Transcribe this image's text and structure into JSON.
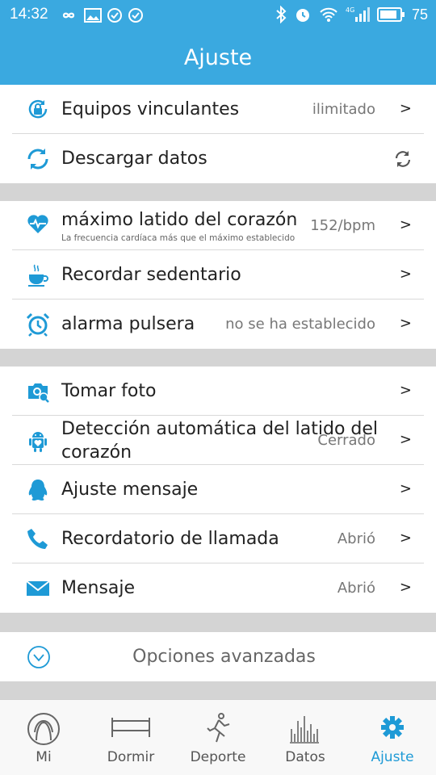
{
  "status_bar": {
    "time": "14:32",
    "battery": "75",
    "signal_label": "4G"
  },
  "header": {
    "title": "Ajuste"
  },
  "sections": [
    {
      "rows": [
        {
          "label": "Equipos vinculantes",
          "value": "ilimitado",
          "chevron": ">",
          "icon": "lock-sync-icon"
        },
        {
          "label": "Descargar datos",
          "value": "",
          "chevron": "",
          "icon": "sync-icon",
          "action_icon": "refresh-icon"
        }
      ]
    },
    {
      "rows": [
        {
          "label": "máximo latido del corazón",
          "subtitle": "La frecuencia cardíaca más que el máximo establecido",
          "value": "152/bpm",
          "chevron": ">",
          "icon": "heart-pulse-icon"
        },
        {
          "label": "Recordar sedentario",
          "value": "",
          "chevron": ">",
          "icon": "coffee-cup-icon"
        },
        {
          "label": "alarma pulsera",
          "value": "no se ha establecido",
          "chevron": ">",
          "icon": "alarm-clock-icon"
        }
      ]
    },
    {
      "rows": [
        {
          "label": "Tomar foto",
          "value": "",
          "chevron": ">",
          "icon": "camera-icon"
        },
        {
          "label": "Detección automática del latido del",
          "label2": "corazón",
          "value": "Cerrado",
          "chevron": ">",
          "icon": "android-icon"
        },
        {
          "label": "Ajuste mensaje",
          "value": "",
          "chevron": ">",
          "icon": "qq-penguin-icon"
        },
        {
          "label": "Recordatorio de llamada",
          "value": "Abrió",
          "chevron": ">",
          "icon": "phone-icon"
        },
        {
          "label": "Mensaje",
          "value": "Abrió",
          "chevron": ">",
          "icon": "envelope-icon"
        }
      ]
    }
  ],
  "advanced": {
    "label": "Opciones avanzadas",
    "icon": "chevron-down-circle-icon"
  },
  "tabs": [
    {
      "label": "Mi",
      "icon": "user-face-icon",
      "active": false
    },
    {
      "label": "Dormir",
      "icon": "bed-icon",
      "active": false
    },
    {
      "label": "Deporte",
      "icon": "runner-icon",
      "active": false
    },
    {
      "label": "Datos",
      "icon": "bar-chart-icon",
      "active": false
    },
    {
      "label": "Ajuste",
      "icon": "gear-icon",
      "active": true
    }
  ],
  "colors": {
    "accent": "#3aa9e0",
    "icon_blue": "#1e9ad6",
    "divider": "#d4d4d4"
  }
}
